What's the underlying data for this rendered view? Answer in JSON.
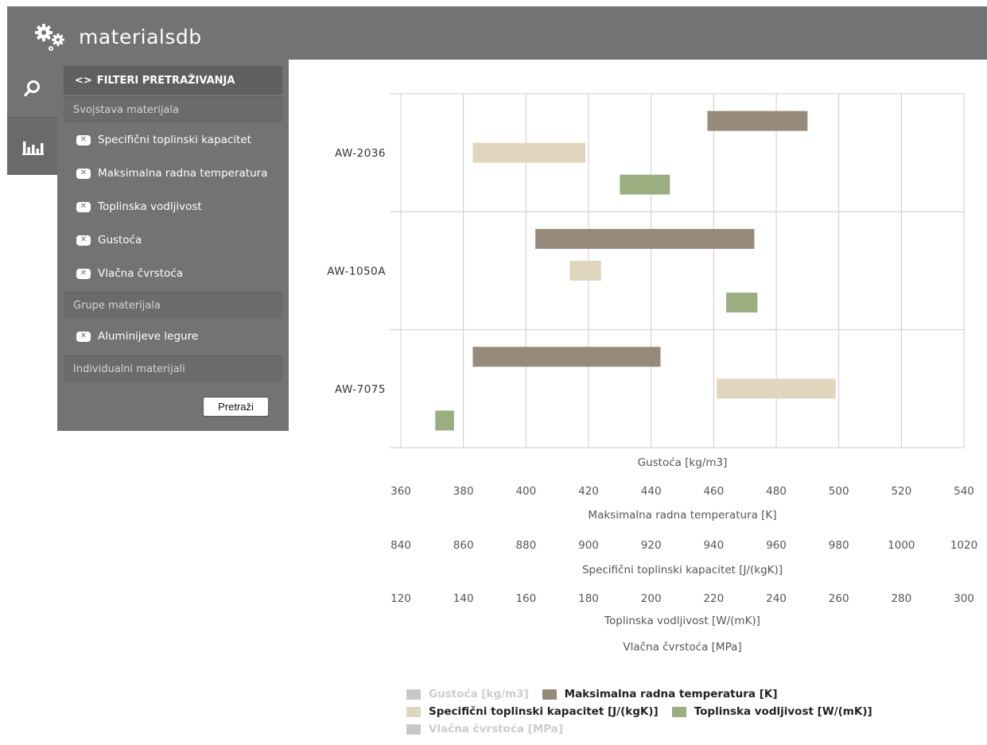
{
  "app": {
    "brand": "materialsdb"
  },
  "rail": {
    "items": [
      {
        "icon": "search-icon"
      },
      {
        "icon": "bar-chart-icon"
      }
    ]
  },
  "panel": {
    "title": "FILTERI PRETRAŽIVANJA",
    "title_icon": "<>",
    "groups": [
      {
        "label": "Svojstava materijala",
        "items": [
          "Specifični toplinski kapacitet",
          "Maksimalna radna temperatura",
          "Toplinska vodljivost",
          "Gustoća",
          "Vlačna čvrstoća"
        ]
      },
      {
        "label": "Grupe materijala",
        "items": [
          "Aluminijeve legure"
        ]
      },
      {
        "label": "Individualni materijali",
        "items": []
      }
    ],
    "search_button": "Pretraži"
  },
  "colors": {
    "topbar": "#737373",
    "gustoca": "#c8c8c8",
    "temperatura": "#968b7a",
    "kapacitet": "#e0d6bd",
    "vodljivost": "#9bae80",
    "vlacna": "#c8c8c8",
    "grid": "#cccccc",
    "axis_text": "#555555"
  },
  "chart_data": {
    "type": "range-bar",
    "orientation": "horizontal",
    "grid": true,
    "categories": [
      "AW-2036",
      "AW-1050A",
      "AW-7075"
    ],
    "axes": [
      {
        "title": "Gustoća [kg/m3]",
        "ticks": []
      },
      {
        "title": "Maksimalna radna temperatura [K]",
        "min": 360,
        "max": 540,
        "ticks": [
          360,
          380,
          400,
          420,
          440,
          460,
          480,
          500,
          520,
          540
        ]
      },
      {
        "title": "Specifični toplinski kapacitet [J/(kgK)]",
        "min": 840,
        "max": 1020,
        "ticks": [
          840,
          860,
          880,
          900,
          920,
          940,
          960,
          980,
          1000,
          1020
        ]
      },
      {
        "title": "Toplinska vodljivost [W/(mK)]",
        "min": 120,
        "max": 300,
        "ticks": [
          120,
          140,
          160,
          180,
          200,
          220,
          240,
          260,
          280,
          300
        ]
      },
      {
        "title": "Vlačna čvrstoća [MPa]",
        "ticks": []
      }
    ],
    "series": [
      {
        "name": "Gustoća [kg/m3]",
        "visible": false,
        "color": "#c8c8c8",
        "ranges": []
      },
      {
        "name": "Maksimalna radna temperatura [K]",
        "visible": true,
        "color": "#968b7a",
        "axis": 1,
        "offset": 0.27,
        "ranges": [
          [
            458,
            490
          ],
          [
            403,
            473
          ],
          [
            383,
            443
          ]
        ]
      },
      {
        "name": "Specifični toplinski kapacitet [J/(kgK)]",
        "visible": true,
        "color": "#e0d6bd",
        "axis": 2,
        "offset": 0,
        "ranges": [
          [
            863,
            899
          ],
          [
            894,
            904
          ],
          [
            941,
            979
          ]
        ]
      },
      {
        "name": "Toplinska vodljivost [W/(mK)]",
        "visible": true,
        "color": "#9bae80",
        "axis": 3,
        "offset": -0.27,
        "ranges": [
          [
            190,
            206
          ],
          [
            224,
            234
          ],
          [
            131,
            137
          ]
        ]
      },
      {
        "name": "Vlačna čvrstoća [MPa]",
        "visible": false,
        "color": "#c8c8c8",
        "ranges": []
      }
    ],
    "legend_position": "bottom"
  }
}
